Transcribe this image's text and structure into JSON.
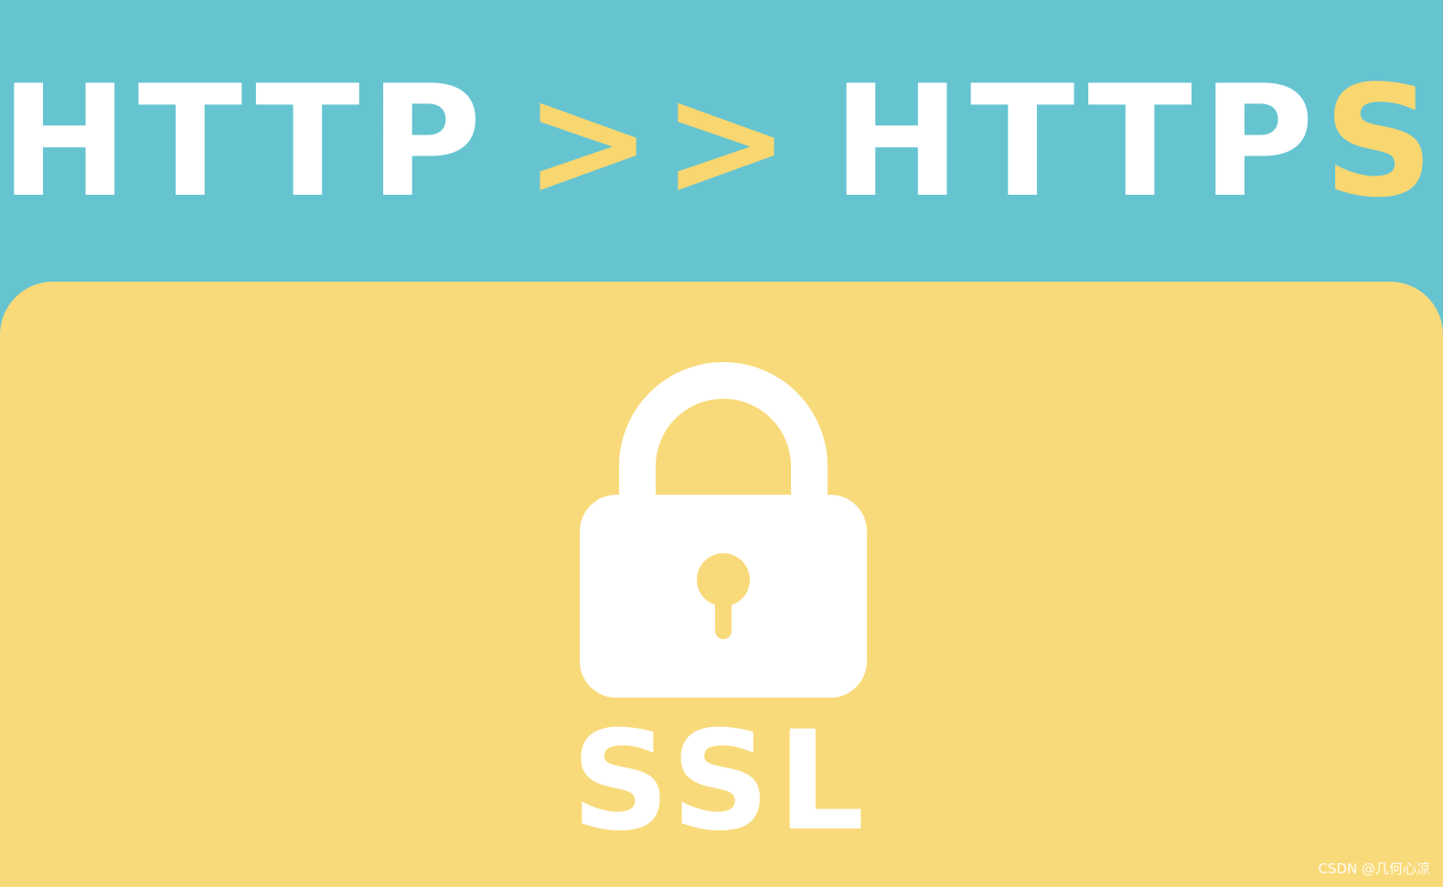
{
  "headline": {
    "left_word": "HTTP",
    "separator": ">>",
    "right_word_base": "HTTP",
    "right_word_suffix": "S"
  },
  "badge": {
    "icon": "lock-icon",
    "label": "SSL"
  },
  "watermark": "CSDN @几何心凉",
  "colors": {
    "sky_blue": "#66C4D1",
    "yellow": "#F9DA7A",
    "accent_yellow": "#F8D670",
    "white": "#FFFFFF"
  }
}
